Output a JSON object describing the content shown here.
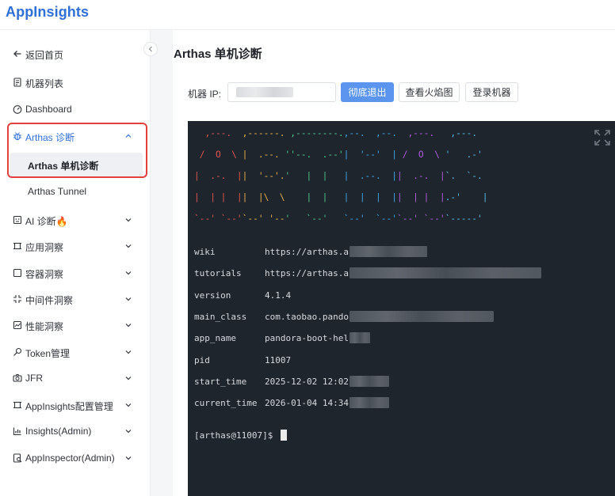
{
  "app": {
    "logo": "AppInsights"
  },
  "sidebar": {
    "back": "返回首页",
    "items": [
      {
        "label": "机器列表",
        "icon": "server-icon"
      },
      {
        "label": "Dashboard",
        "icon": "dashboard-icon"
      },
      {
        "label": "Arthas 诊断",
        "icon": "bug-icon",
        "expanded": true,
        "children": [
          {
            "label": "Arthas 单机诊断",
            "selected": true
          },
          {
            "label": "Arthas Tunnel"
          }
        ]
      },
      {
        "label": "AI 诊断🔥",
        "icon": "ai-icon"
      },
      {
        "label": "应用洞察",
        "icon": "app-icon"
      },
      {
        "label": "容器洞察",
        "icon": "container-icon"
      },
      {
        "label": "中间件洞察",
        "icon": "middleware-icon"
      },
      {
        "label": "性能洞察",
        "icon": "performance-icon"
      },
      {
        "label": "Token管理",
        "icon": "key-icon"
      },
      {
        "label": "JFR",
        "icon": "camera-icon"
      },
      {
        "label": "AppInsights配置管理",
        "icon": "config-icon"
      },
      {
        "label": "Insights(Admin)",
        "icon": "chart-icon"
      },
      {
        "label": "AppInspector(Admin)",
        "icon": "inspector-icon"
      }
    ]
  },
  "main": {
    "title": "Arthas 单机诊断",
    "ip_label": "机器 IP:",
    "ip_placeholder": "",
    "buttons": {
      "exit": "彻底退出",
      "flame": "查看火焰图",
      "login": "登录机器"
    }
  },
  "terminal": {
    "banner": [
      "  ,---.  ,------. ,--------.,--.  ,--.  ,---.   ,---.",
      " /  O  \\ |  .--. ''--.  .--'|  '--'  | /  O  \\ '   .-'",
      "|  .-.  ||  '--'.'   |  |   |  .--.  ||  .-.  |`.  `-.",
      "|  | |  ||  |\\  \\    |  |   |  |  |  ||  | |  |.-'    |",
      "`--' `--'`--' '--'   `--'   `--'  `--'`--' `--'`-----'"
    ],
    "info": [
      {
        "key": "wiki",
        "value": "https://arthas.a"
      },
      {
        "key": "tutorials",
        "value": "https://arthas.a"
      },
      {
        "key": "version",
        "value": "4.1.4"
      },
      {
        "key": "main_class",
        "value": "com.taobao.pando"
      },
      {
        "key": "app_name",
        "value": "pandora-boot-hel"
      },
      {
        "key": "pid",
        "value": "11007"
      },
      {
        "key": "start_time",
        "value": "2025-12-02 12:02"
      },
      {
        "key": "current_time",
        "value": "2026-01-04 14:34"
      }
    ],
    "prompt": "[arthas@11007]$ "
  },
  "colors": {
    "accent": "#2f6fd8",
    "primary_button": "#5b95f0",
    "highlight": "#e2413f",
    "terminal_bg": "#1e252d"
  }
}
